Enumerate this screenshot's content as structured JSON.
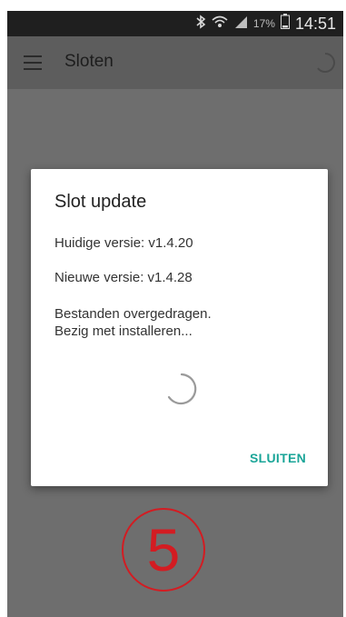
{
  "statusbar": {
    "battery_percent": "17%",
    "time": "14:51",
    "icons": [
      "bluetooth-icon",
      "wifi-icon",
      "signal-icon",
      "battery-icon"
    ]
  },
  "appbar": {
    "title": "Sloten",
    "menu_icon": "hamburger-menu-icon",
    "loading_icon": "spinner-icon"
  },
  "dialog": {
    "title": "Slot update",
    "current_version": "Huidige versie: v1.4.20",
    "new_version": "Nieuwe versie: v1.4.28",
    "status_line1": "Bestanden overgedragen.",
    "status_line2": "Bezig met installeren...",
    "close_button": "SLUITEN",
    "accent_color": "#1aa598"
  },
  "step_marker": {
    "number": "5",
    "color": "#d31c22"
  }
}
